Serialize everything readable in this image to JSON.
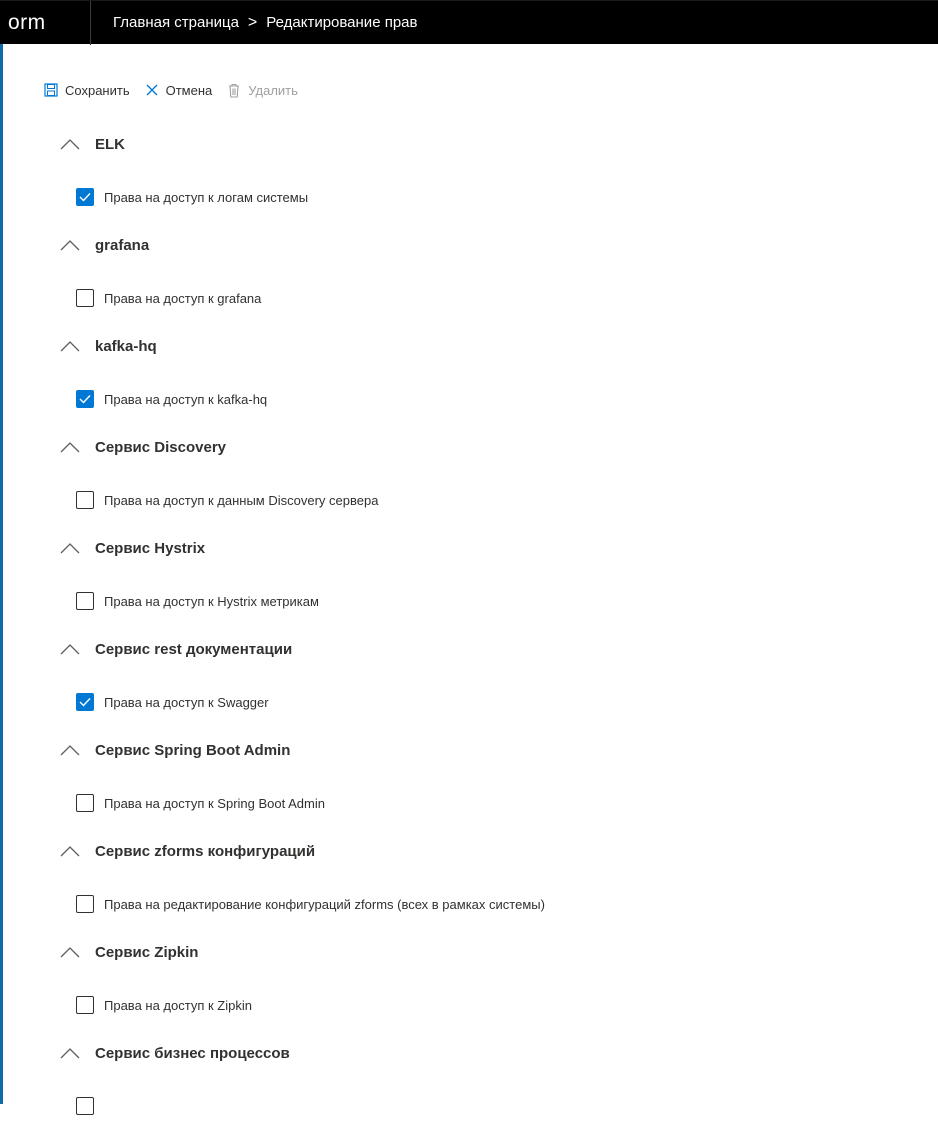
{
  "app": {
    "brand": "orm"
  },
  "breadcrumb": {
    "items": [
      "Главная страница",
      "Редактирование прав"
    ],
    "separator": ">"
  },
  "toolbar": {
    "save_label": "Сохранить",
    "cancel_label": "Отмена",
    "delete_label": "Удалить"
  },
  "colors": {
    "accent": "#0078d4",
    "topbar": "#000000"
  },
  "groups": [
    {
      "title": "ELK",
      "item": "Права на доступ к логам системы",
      "checked": true
    },
    {
      "title": "grafana",
      "item": "Права на доступ к grafana",
      "checked": false
    },
    {
      "title": "kafka-hq",
      "item": "Права на доступ к kafka-hq",
      "checked": true
    },
    {
      "title": "Сервис Discovery",
      "item": "Права на доступ к данным Discovery сервера",
      "checked": false
    },
    {
      "title": "Сервис Hystrix",
      "item": "Права на доступ к Hystrix метрикам",
      "checked": false
    },
    {
      "title": "Сервис rest документации",
      "item": "Права на доступ к Swagger",
      "checked": true
    },
    {
      "title": "Сервис Spring Boot Admin",
      "item": "Права на доступ к Spring Boot Admin",
      "checked": false
    },
    {
      "title": "Сервис zforms конфигураций",
      "item": "Права на редактирование конфигураций zforms (всех в рамках системы)",
      "checked": false
    },
    {
      "title": "Сервис Zipkin",
      "item": "Права на доступ к Zipkin",
      "checked": false
    },
    {
      "title": "Сервис бизнес процессов",
      "item": "",
      "checked": false
    }
  ]
}
